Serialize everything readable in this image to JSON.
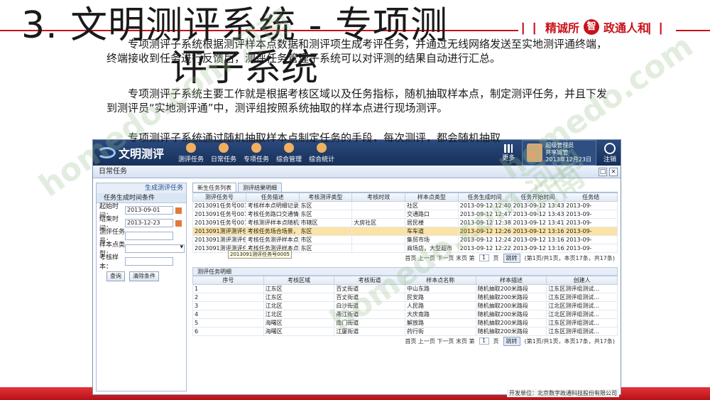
{
  "slide": {
    "title_line1": "3. 文明测评系统 - 专项测",
    "title_line2": "评子系统",
    "brand_left": "⎸⎸精诚所",
    "brand_zhi": "智",
    "brand_right": "政通人和⎸⎸",
    "para1": "专项测评子系统根据测评样本点数据和测评项生成考评任务，并通过无线网络发送至实地测评通终端，终端接收到任务进行反馈后，测评任务管理子系统可以对评测的结果自动进行汇总。",
    "para2": "专项测评子系统主要工作就是根据考核区域以及任务指标，随机抽取样本点，制定测评任务，并且下发到测评员“实地测评通”中，测评组按照系统抽取的样本点进行现场测评。",
    "para3": "专项测评子系统通过随机抽取样本点制定任务的手段，每次测评，都会随机抽取",
    "watermark": "homedo.com 河南"
  },
  "app": {
    "logo": "文明测评",
    "nav": [
      "测评任务",
      "日常任务",
      "专项任务",
      "综合管理",
      "综合统计"
    ],
    "more_label": "更多",
    "user_line1": "超级管理员",
    "user_line2": "共享城管",
    "user_line3": "2013年12月23日",
    "exit_label": "注销",
    "panel_title": "日常任务",
    "left_head": "生成测评任务",
    "left_sub": "任务生成时间条件",
    "start_label": "起始时间：",
    "start_value": "2013-09-01",
    "end_label": "结束时间：",
    "end_value": "2013-12-23",
    "task_no_label": "测评任务号：",
    "type_label": "样本点类型：",
    "name_label": "考核样本：",
    "query_btn": "查询",
    "clear_btn": "清除条件",
    "tab1": "新生任务列表",
    "tab2": "测评结果明细",
    "columns": [
      "测评任务号",
      "任务描述",
      "考核测评类型",
      "考核时效",
      "样本点类型",
      "任务生成时间",
      "任务开始时间",
      "任务结"
    ],
    "rows": [
      [
        "2013091任务号0018",
        "考核样本点明细记录",
        "东区",
        "",
        "社区",
        "2013-09-12 12:40:49",
        "2013-09-12 13:43:47",
        "2013-09-"
      ],
      [
        "2013091任务号0015",
        "考核任务路口交通情况",
        "东区",
        "",
        "交通路口",
        "2013-09-12 12:47:50",
        "2013-09-12 13:43:47",
        "2013-09-"
      ],
      [
        "2013091任务号0014",
        "考核测评样本点随机抽取",
        "市辖区",
        "大房社区",
        "居民楼",
        "2013-09-12 12:38:00",
        "2013-09-12 13:41:10",
        "2013-09-"
      ],
      [
        "2013091测评测评任",
        "考核任务场合场景，每个样本点",
        "东区",
        "",
        "车车道",
        "2013-09-12 12:26:39",
        "2013-09-12 13:16:12",
        "2013-09-"
      ],
      [
        "2013091测评测评任",
        "考核任务测评样本点，每个样本",
        "市区",
        "",
        "集贸市场",
        "2013-09-12 12:24:00",
        "2013-09-12 13:16:12",
        "2013-09-"
      ],
      [
        "2013091测评测评任",
        "考核任务测评样本点，大型超市",
        "东区",
        "",
        "商场店，大型超市",
        "2013-09-12 12:22:20",
        "2013-09-12 13:16:12",
        "2013-09-"
      ]
    ],
    "tooltip": "2013091测评任务号0005",
    "pager": "首页 上一页 下一页 末页 第",
    "page_no": "1",
    "page_suffix": "页",
    "go_btn": "跳转",
    "pager_info": "(第1页/共1页，本页17条，共17条)",
    "detail_title": "测评任务明细",
    "detail_columns": [
      "序号",
      "考核区域",
      "考核街道",
      "样本点名称",
      "样本描述",
      "创建人"
    ],
    "detail_rows": [
      [
        "1",
        "江东区",
        "百丈街道",
        "中山东路",
        "随机抽取200米路段",
        "江东区测评组测试..."
      ],
      [
        "2",
        "江东区",
        "百丈街道",
        "民安路",
        "随机抽取200米路段",
        "江东区测评组测试..."
      ],
      [
        "3",
        "江北区",
        "白沙街道",
        "人民路",
        "随机抽取200米路段",
        "江北区测评组测试..."
      ],
      [
        "4",
        "江北区",
        "甬江街道",
        "大庆南路",
        "随机抽取200米路段",
        "江北区测评组测试..."
      ],
      [
        "5",
        "海曙区",
        "南门街道",
        "解放路",
        "随机抽取200米路段",
        "江东区测评组测试..."
      ],
      [
        "6",
        "海曙区",
        "江厦街道",
        "药行街",
        "随机抽取200米路段",
        "江东区测评组测试..."
      ]
    ],
    "footer": "开发单位：北京数字政通科技股份有限公司"
  },
  "colors": {
    "accent": "#c8121a",
    "app_header": "#1f3d6c",
    "highlight_row": "#fbe3a6"
  }
}
